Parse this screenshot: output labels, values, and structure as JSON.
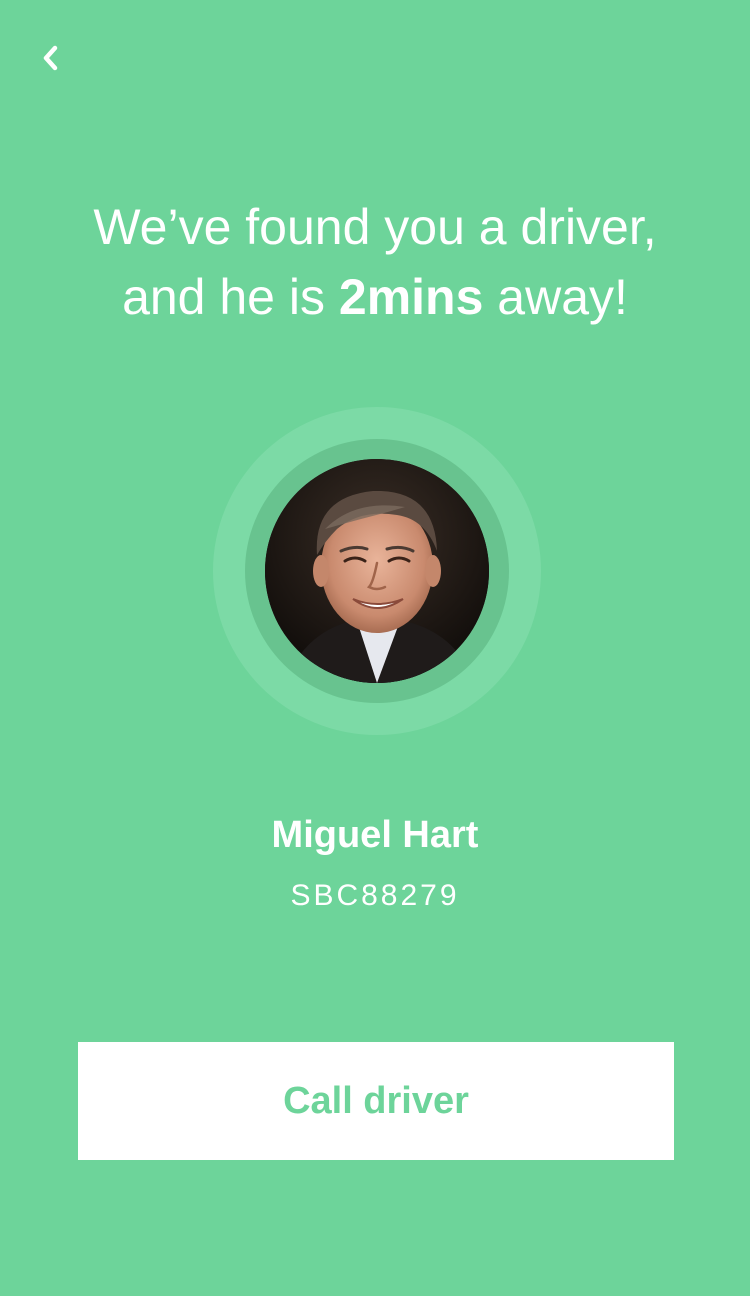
{
  "colors": {
    "background": "#6dd49a",
    "ring_outer": "#7cdaa6",
    "ring_inner": "#68c38f",
    "button_bg": "#ffffff",
    "button_text": "#6dd49a"
  },
  "nav": {
    "back_icon": "chevron-left-icon"
  },
  "headline": {
    "line1": "We’ve found you a driver,",
    "line2_prefix": "and he is ",
    "line2_emphasis": "2mins",
    "line2_suffix": " away!"
  },
  "driver": {
    "avatar_icon": "driver-photo",
    "name": "Miguel Hart",
    "plate": "SBC88279"
  },
  "actions": {
    "call_label": "Call driver"
  }
}
